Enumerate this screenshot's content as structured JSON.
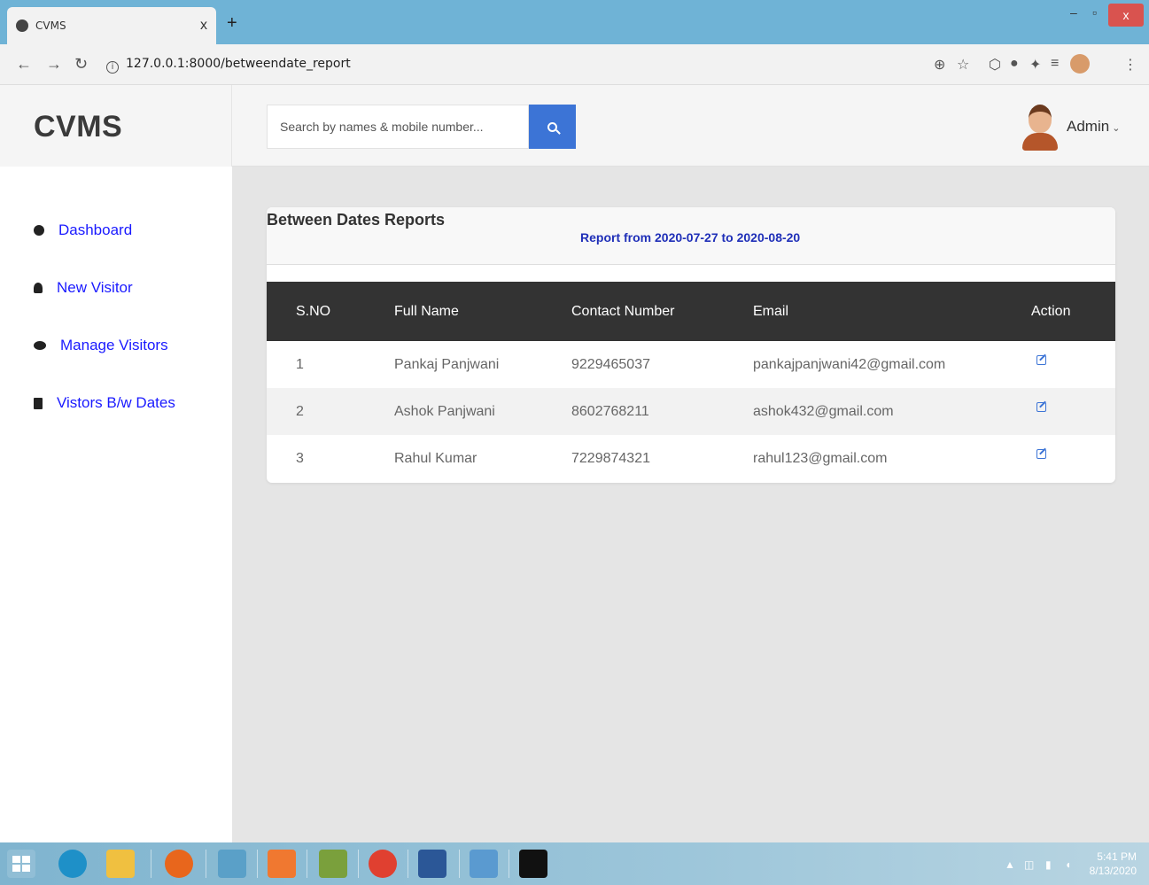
{
  "browser": {
    "tab_title": "CVMS",
    "tab_close": "x",
    "new_tab": "+",
    "url": "127.0.0.1:8000/betweendate_report",
    "win_min": "–",
    "win_max": "▫",
    "win_close": "x"
  },
  "app": {
    "brand": "CVMS",
    "search_placeholder": "Search by names & mobile number...",
    "user_name": "Admin"
  },
  "sidebar": {
    "items": [
      {
        "label": "Dashboard",
        "icon": "dashboard-icon"
      },
      {
        "label": "New Visitor",
        "icon": "user-icon"
      },
      {
        "label": "Manage Visitors",
        "icon": "users-icon"
      },
      {
        "label": "Vistors B/w Dates",
        "icon": "copy-icon"
      }
    ]
  },
  "report": {
    "title": "Between Dates Reports",
    "subtitle": "Report from 2020-07-27 to 2020-08-20",
    "columns": [
      "S.NO",
      "Full Name",
      "Contact Number",
      "Email",
      "Action"
    ],
    "rows": [
      {
        "sno": "1",
        "name": "Pankaj Panjwani",
        "contact": "9229465037",
        "email": "pankajpanjwani42@gmail.com"
      },
      {
        "sno": "2",
        "name": "Ashok Panjwani",
        "contact": "8602768211",
        "email": "ashok432@gmail.com"
      },
      {
        "sno": "3",
        "name": "Rahul Kumar",
        "contact": "7229874321",
        "email": "rahul123@gmail.com"
      }
    ]
  },
  "taskbar": {
    "time": "5:41 PM",
    "date": "8/13/2020"
  },
  "colors": {
    "accent": "#3c74d6",
    "sidebar_link": "#1a1aff",
    "table_header": "#333333"
  }
}
